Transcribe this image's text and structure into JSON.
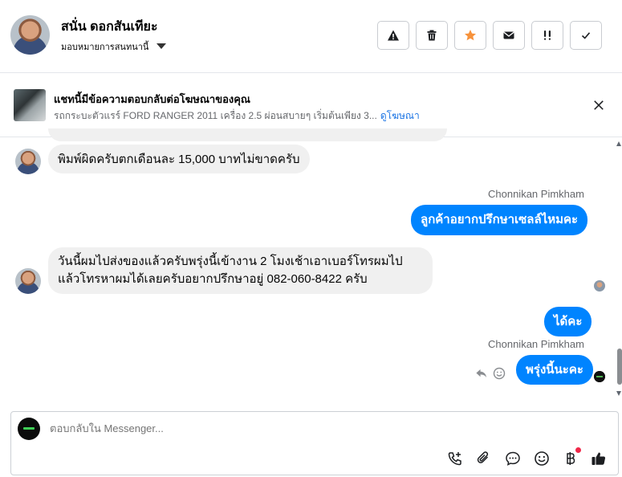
{
  "header": {
    "contact_name": "สนั่น ดอกสันเทียะ",
    "assign_label": "มอบหมายการสนทนานี้",
    "actions": [
      {
        "name": "spam",
        "icon": "warning-icon"
      },
      {
        "name": "delete",
        "icon": "trash-icon"
      },
      {
        "name": "star",
        "icon": "star-icon",
        "color": "#f7923b"
      },
      {
        "name": "unread",
        "icon": "envelope-icon"
      },
      {
        "name": "follow-up",
        "icon": "double-exclamation-icon"
      },
      {
        "name": "done",
        "icon": "check-icon"
      }
    ]
  },
  "banner": {
    "title": "แชทนี้มีข้อความตอบกลับต่อโฆษณาของคุณ",
    "subtitle": "รถกระบะตัวแรร์ FORD RANGER 2011 เครื่อง 2.5 ผ่อนสบายๆ เริ่มต้นเพียง 3...",
    "link": "ดูโฆษณา"
  },
  "messages": {
    "m1": "พิมพ์ผิดครับตกเดือนละ 15,000 บาทไม่ขาดครับ",
    "m2_sender": "Chonnikan Pimkham",
    "m2": "ลูกค้าอยากปรึกษาเซลล์ไหมคะ",
    "m3_line1": "วันนี้ผมไปส่งของแล้วครับพรุ่งนี้เข้างาน 2 โมงเช้าเอาเบอร์โทรผมไป",
    "m3_line2": "แล้วโทรหาผมได้เลยครับอยากปรึกษาอยู่ 082-060-8422 ครับ",
    "m4": "ได้คะ",
    "m5_sender": "Chonnikan Pimkham",
    "m5": "พรุ่งนี้นะคะ"
  },
  "composer": {
    "placeholder": "ตอบกลับใน Messenger..."
  },
  "colors": {
    "accent": "#0084ff",
    "star": "#f7923b",
    "link": "#1b74e4",
    "notification": "#f02849"
  }
}
